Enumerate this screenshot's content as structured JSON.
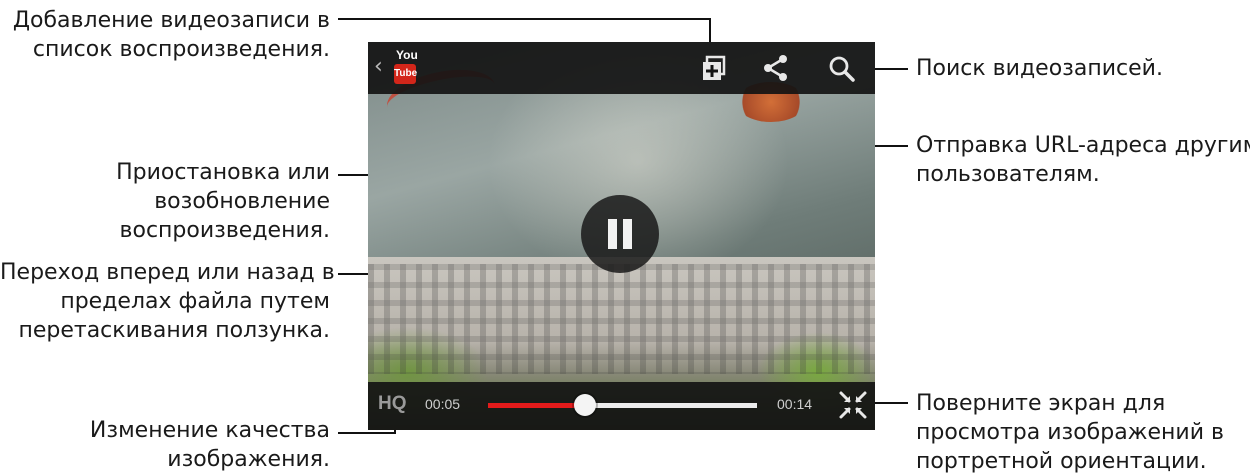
{
  "callouts": {
    "add_to_playlist": [
      "Добавление видеозаписи в",
      "список воспроизведения."
    ],
    "pause_resume": [
      "Приостановка или",
      "возобновление",
      "воспроизведения."
    ],
    "seek": [
      "Переход вперед или назад в",
      "пределах файла путем",
      "перетаскивания ползунка."
    ],
    "quality": [
      "Изменение качества",
      "изображения."
    ],
    "search": [
      "Поиск видеозаписей."
    ],
    "share": [
      "Отправка URL-адреса другим",
      "пользователям."
    ],
    "rotate": [
      "Поверните экран для",
      "просмотра изображений в",
      "портретной ориентации."
    ]
  },
  "player": {
    "logo_top": "You",
    "logo_bottom": "Tube",
    "quality_label": "HQ",
    "time_current": "00:05",
    "time_total": "00:14",
    "progress_fraction": 0.36,
    "progress_color": "#e31b1b",
    "icons": [
      "back-chevron-icon",
      "youtube-logo",
      "add-to-playlist-icon",
      "share-icon",
      "search-icon",
      "pause-icon",
      "rotate-screen-icon"
    ]
  }
}
